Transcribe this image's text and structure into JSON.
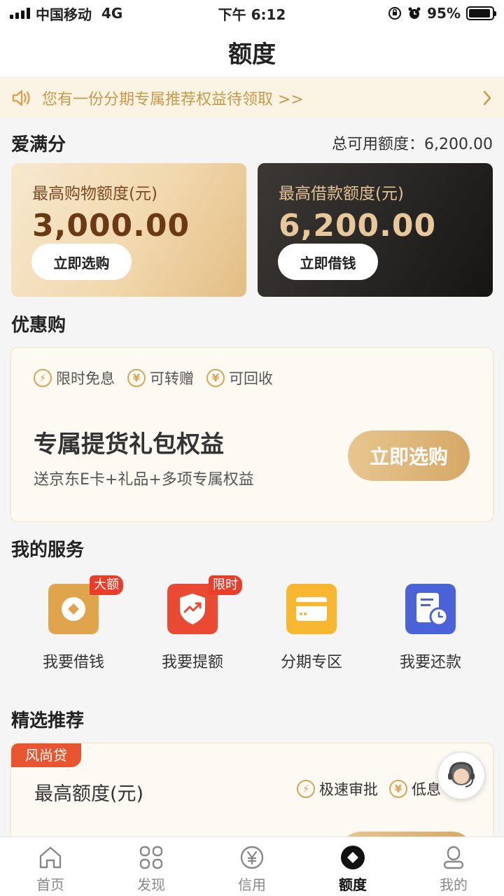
{
  "status_bar": {
    "carrier": "中国移动",
    "network": "4G",
    "time": "下午 6:12",
    "battery": "95%",
    "battery_level": 0.95
  },
  "header": {
    "title": "额度"
  },
  "notice": {
    "text": "您有一份分期专属推荐权益待领取 >>",
    "icon": "speaker-icon",
    "color": "#c79a4a"
  },
  "credit": {
    "section_title": "爱满分",
    "total_label": "总可用额度：6,200.00",
    "shop": {
      "label": "最高购物额度(元)",
      "amount": "3,000.00",
      "button": "立即选购"
    },
    "loan": {
      "label": "最高借款额度(元)",
      "amount": "6,200.00",
      "button": "立即借钱"
    }
  },
  "promo": {
    "section_title": "优惠购",
    "tags": [
      {
        "icon": "lightning-icon",
        "label": "限时免息"
      },
      {
        "icon": "yen-icon",
        "label": "可转赠"
      },
      {
        "icon": "yen-icon",
        "label": "可回收"
      }
    ],
    "title": "专属提货礼包权益",
    "subtitle": "送京东E卡+礼品+多项专属权益",
    "button": "立即选购"
  },
  "services": {
    "section_title": "我的服务",
    "items": [
      {
        "label": "我要借钱",
        "badge": "大额",
        "icon": "diamond-coin-icon",
        "color": "#e0a54c"
      },
      {
        "label": "我要提额",
        "badge": "限时",
        "icon": "shield-trend-icon",
        "color": "#ea4a33"
      },
      {
        "label": "分期专区",
        "badge": "",
        "icon": "card-icon",
        "color": "#f7b731"
      },
      {
        "label": "我要还款",
        "badge": "",
        "icon": "bill-clock-icon",
        "color": "#4a63d8"
      }
    ]
  },
  "recommend": {
    "section_title": "精选推荐",
    "tag": "风尚贷",
    "title": "最高额度(元)",
    "features": [
      {
        "icon": "lightning-icon",
        "label": "极速审批"
      },
      {
        "icon": "yen-icon",
        "label": "低息"
      }
    ]
  },
  "support": {
    "icon": "customer-service-icon"
  },
  "tabbar": {
    "items": [
      {
        "label": "首页",
        "icon": "home-icon",
        "active": false
      },
      {
        "label": "发现",
        "icon": "grid-icon",
        "active": false
      },
      {
        "label": "信用",
        "icon": "yen-circle-icon",
        "active": false
      },
      {
        "label": "额度",
        "icon": "diamond-icon",
        "active": true
      },
      {
        "label": "我的",
        "icon": "user-icon",
        "active": false
      }
    ]
  }
}
